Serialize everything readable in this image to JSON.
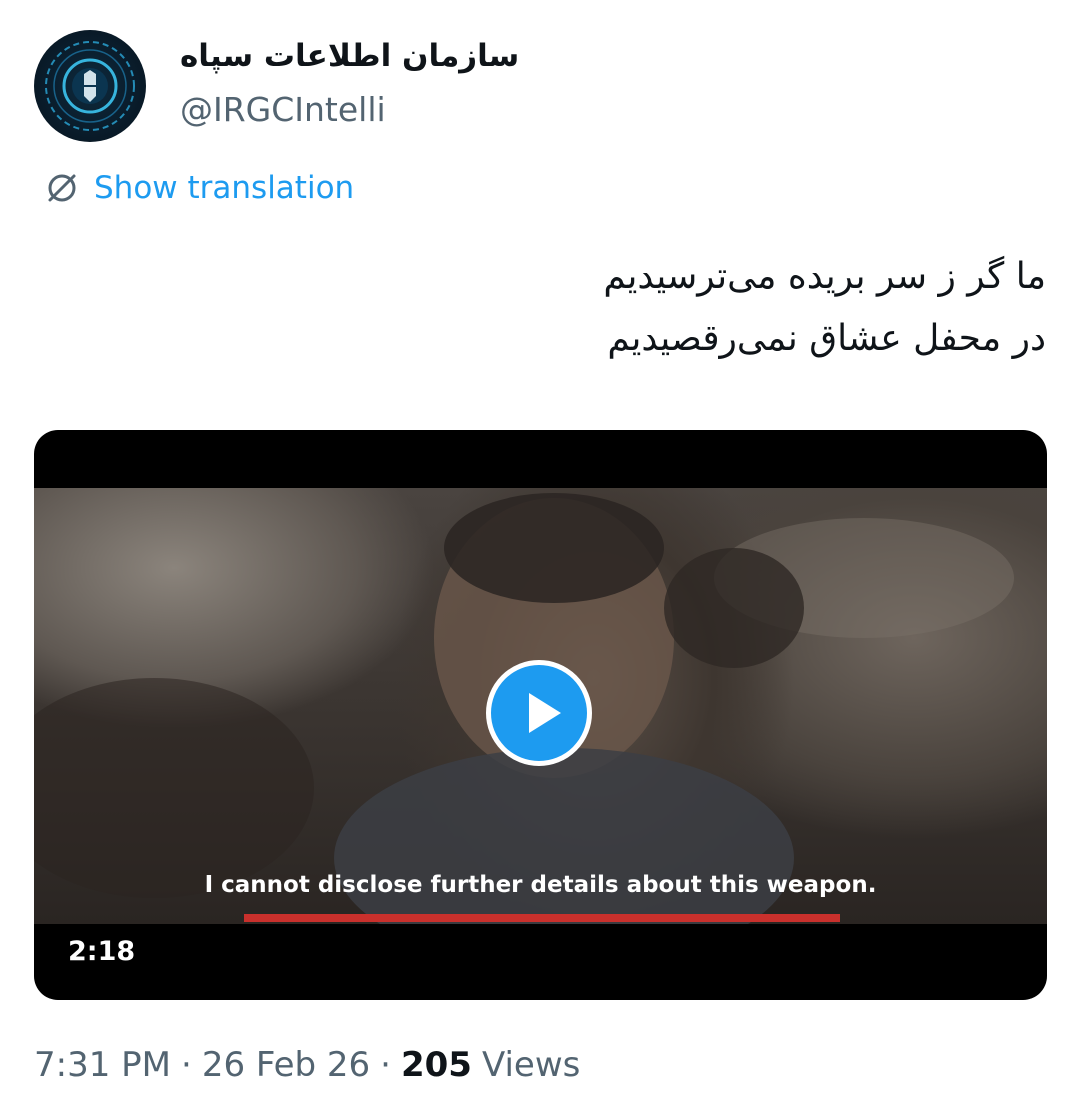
{
  "author": {
    "display_name": "سازمان اطلاعات سپاه",
    "handle": "@IRGCIntelli"
  },
  "translate": {
    "label": "Show translation",
    "icon": "translate-icon"
  },
  "tweet": {
    "lines": [
      "ما گر ز سر بریده می‌ترسیدیم",
      "در محفل عشاق نمی‌رقصیدیم"
    ]
  },
  "media": {
    "subtitle": "I cannot disclose further details about this weapon.",
    "duration": "2:18",
    "play_icon": "play-icon"
  },
  "meta": {
    "time": "7:31 PM",
    "separator": "·",
    "date": "26 Feb 26",
    "views_count": "205",
    "views_label": "Views"
  },
  "colors": {
    "accent": "#1d9bf0",
    "text": "#0f1419",
    "secondary": "#536471"
  }
}
